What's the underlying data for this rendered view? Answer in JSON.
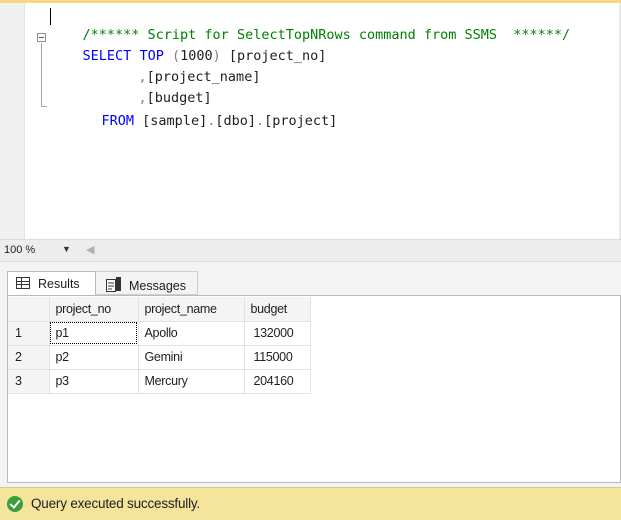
{
  "editor": {
    "lines": [
      {
        "comment": "/****** Script for SelectTopNRows command from SSMS  ******/"
      },
      {
        "kw1": "SELECT",
        "kw2": "TOP",
        "rest_open": " (",
        "number": "1000",
        "rest_close": ") ",
        "col": "[project_no]"
      },
      {
        "comma": ",",
        "col": "[project_name]"
      },
      {
        "comma": ",",
        "col": "[budget]"
      },
      {
        "kw": "FROM",
        "t1": "[sample]",
        "dot1": ".",
        "t2": "[dbo]",
        "dot2": ".",
        "t3": "[project]"
      }
    ]
  },
  "zoom": {
    "value": "100 %",
    "dropdown_icon": "caret-down-icon"
  },
  "tabs": [
    {
      "label": "Results",
      "icon": "grid-icon",
      "active": true
    },
    {
      "label": "Messages",
      "icon": "messages-icon",
      "active": false
    }
  ],
  "grid": {
    "columns": [
      "project_no",
      "project_name",
      "budget"
    ],
    "rows": [
      {
        "num": "1",
        "project_no": "p1",
        "project_name": "Apollo",
        "budget": "132000"
      },
      {
        "num": "2",
        "project_no": "p2",
        "project_name": "Gemini",
        "budget": "115000"
      },
      {
        "num": "3",
        "project_no": "p3",
        "project_name": "Mercury",
        "budget": "204160"
      }
    ]
  },
  "status": {
    "text": "Query executed successfully.",
    "icon": "success-check-icon",
    "color": "#f5e49c"
  }
}
